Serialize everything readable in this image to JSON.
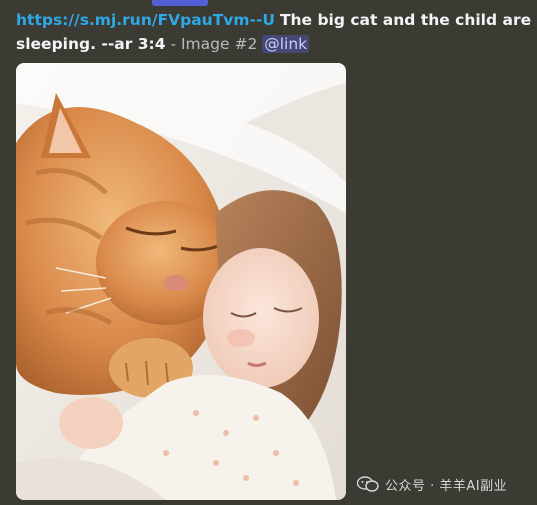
{
  "message": {
    "url": "https://s.mj.run/FVpauTvm--U",
    "prompt_line1": "The big cat and the child are",
    "prompt_line2": "sleeping. --ar 3:4",
    "separator": " - ",
    "image_label": "Image #2",
    "mention": "@link"
  },
  "image": {
    "subject": "orange-cat-and-sleeping-child"
  },
  "watermark": {
    "text": "公众号 · 羊羊AI副业",
    "icon": "wechat-icon"
  },
  "colors": {
    "background": "#3b3a33",
    "link": "#2fa8e6",
    "mention_bg": "#5865f2"
  }
}
